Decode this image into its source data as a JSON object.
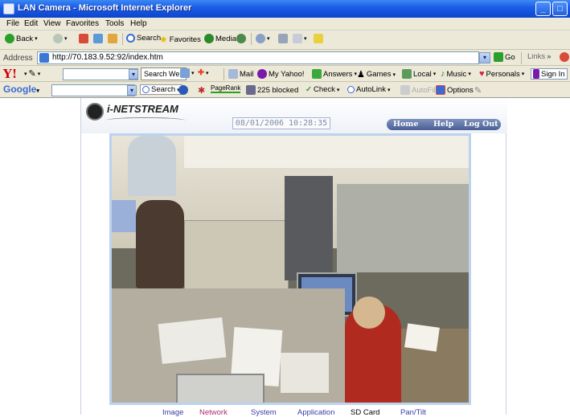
{
  "window": {
    "title": "LAN Camera - Microsoft Internet Explorer",
    "buttons": [
      "_",
      "□"
    ]
  },
  "menu": [
    "File",
    "Edit",
    "View",
    "Favorites",
    "Tools",
    "Help"
  ],
  "standard_toolbar": {
    "back": "Back",
    "search": "Search",
    "favorites": "Favorites",
    "media": "Media"
  },
  "address_bar": {
    "label": "Address",
    "url": "http://70.183.9.52:92/index.htm",
    "go": "Go",
    "links": "Links"
  },
  "yahoo_toolbar": {
    "logo": "Y!",
    "search_button": "Search Web",
    "items": [
      "Mail",
      "My Yahoo!",
      "Answers",
      "Games",
      "Local",
      "Music",
      "Personals",
      "Sign In"
    ]
  },
  "google_toolbar": {
    "logo": "Google",
    "search": "Search",
    "pagerank": "PageRank",
    "blocked": "225 blocked",
    "check": "Check",
    "autolink": "AutoLink",
    "autofill": "AutoFill",
    "options": "Options"
  },
  "camera": {
    "brand": "i-NETSTREAM",
    "datetime": "08/01/2006 10:28:35",
    "nav": [
      "Home",
      "Help",
      "Log Out"
    ],
    "tabs": [
      "Image",
      "Network",
      "System",
      "Application",
      "SD Card",
      "Pan/Tilt"
    ],
    "tab_colors": [
      "#3a3aa8",
      "#b0286a",
      "#3a3aa8",
      "#3a3aa8",
      "#000000",
      "#3a3aa8"
    ]
  }
}
